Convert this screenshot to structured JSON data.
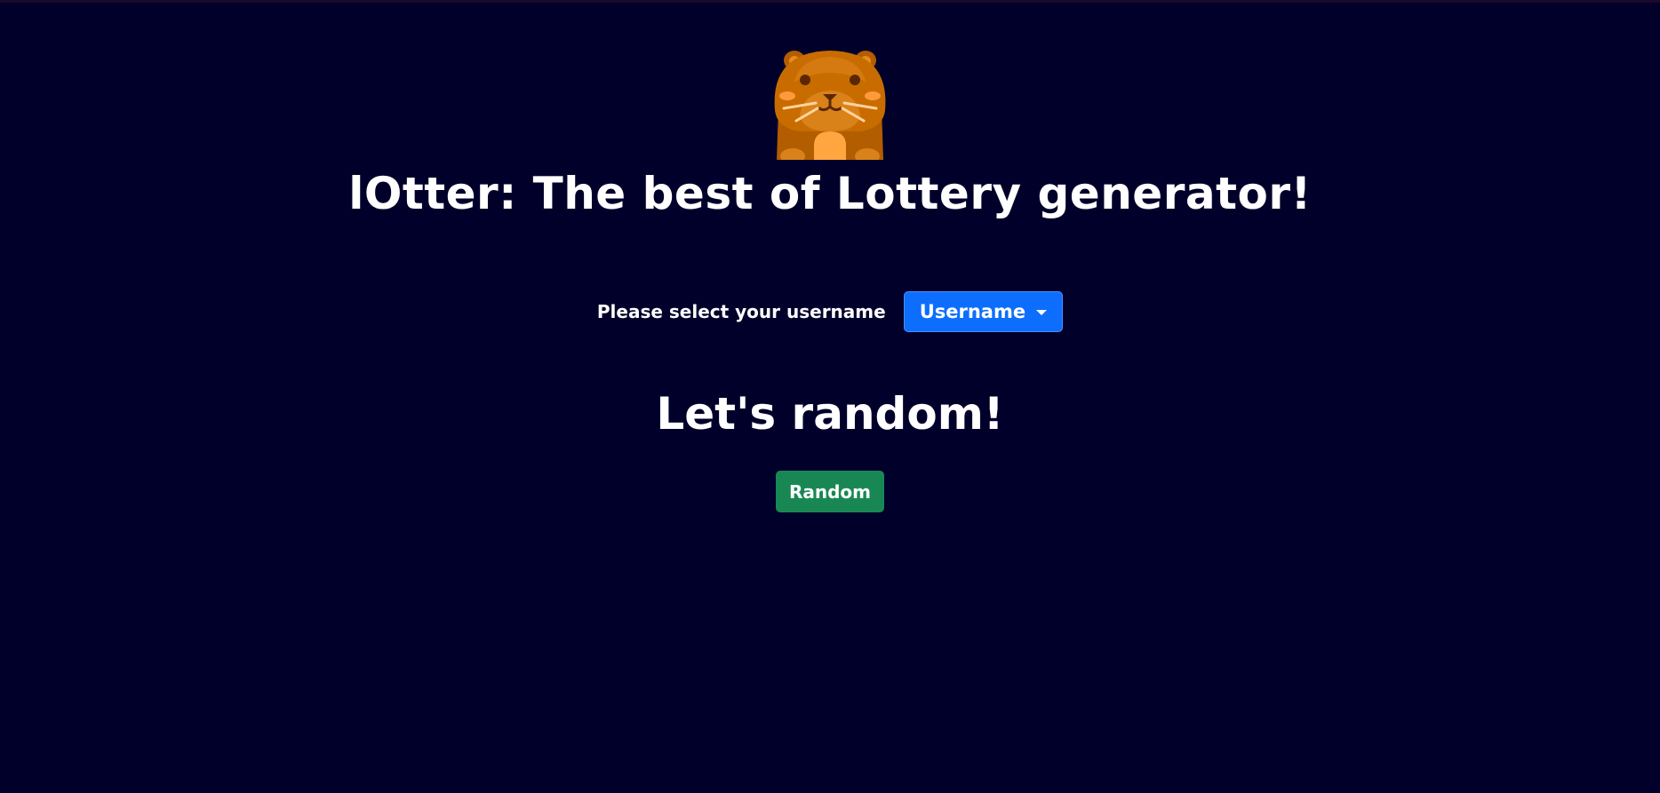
{
  "header": {
    "logo_icon": "otter-icon",
    "title": "lOtter: The best of Lottery generator!"
  },
  "user_select": {
    "label": "Please select your username",
    "dropdown_label": "Username",
    "dropdown_color": "#0d6efd"
  },
  "random_section": {
    "heading": "Let's random!",
    "button_label": "Random",
    "button_color": "#198754"
  },
  "colors": {
    "background": "#01002b",
    "text": "#ffffff"
  }
}
